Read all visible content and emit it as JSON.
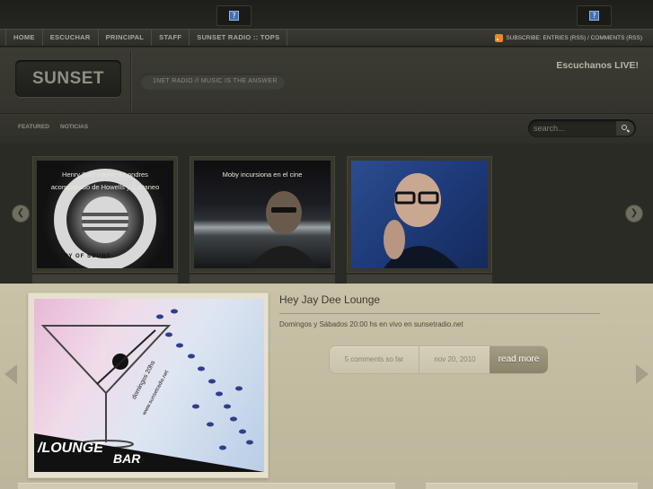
{
  "nav": {
    "items": [
      "HOME",
      "ESCUCHAR",
      "PRINCIPAL",
      "STAFF",
      "SUNSET RADIO :: TOPS"
    ],
    "subscribe": "SUBSCRIBE: ENTRIES (RSS) / COMMENTS (RSS)"
  },
  "header": {
    "logo": "SUNSET",
    "tagline": "1NET RADIO // MUSIC IS THE ANSWER",
    "live": "Escuchanos LIVE!"
  },
  "subnav": {
    "featured": "FEATURED",
    "noticias": "NOTICIAS"
  },
  "search": {
    "placeholder": "search..."
  },
  "featured": {
    "items": [
      {
        "caption": "Henry Saiz vuelve a Londres acompañado de Howells y Cattaneo",
        "image_text": "MINISTRY OF SOUND"
      },
      {
        "caption": "Moby incursiona en el cine"
      },
      {
        "caption": ""
      }
    ]
  },
  "slide": {
    "title": "Hey Jay Dee Lounge",
    "excerpt": "Domingos y Sábados 20:00 hs en vivo en sunsetradio.net",
    "comments": "5 comments so far",
    "date": "nov 20, 2010",
    "read_more": "read more",
    "image_text_main": "/LOUNGE",
    "image_text_bar": "BAR",
    "image_text_side": "domingos 20hs",
    "image_text_url": "www.sunsetradio.net"
  }
}
